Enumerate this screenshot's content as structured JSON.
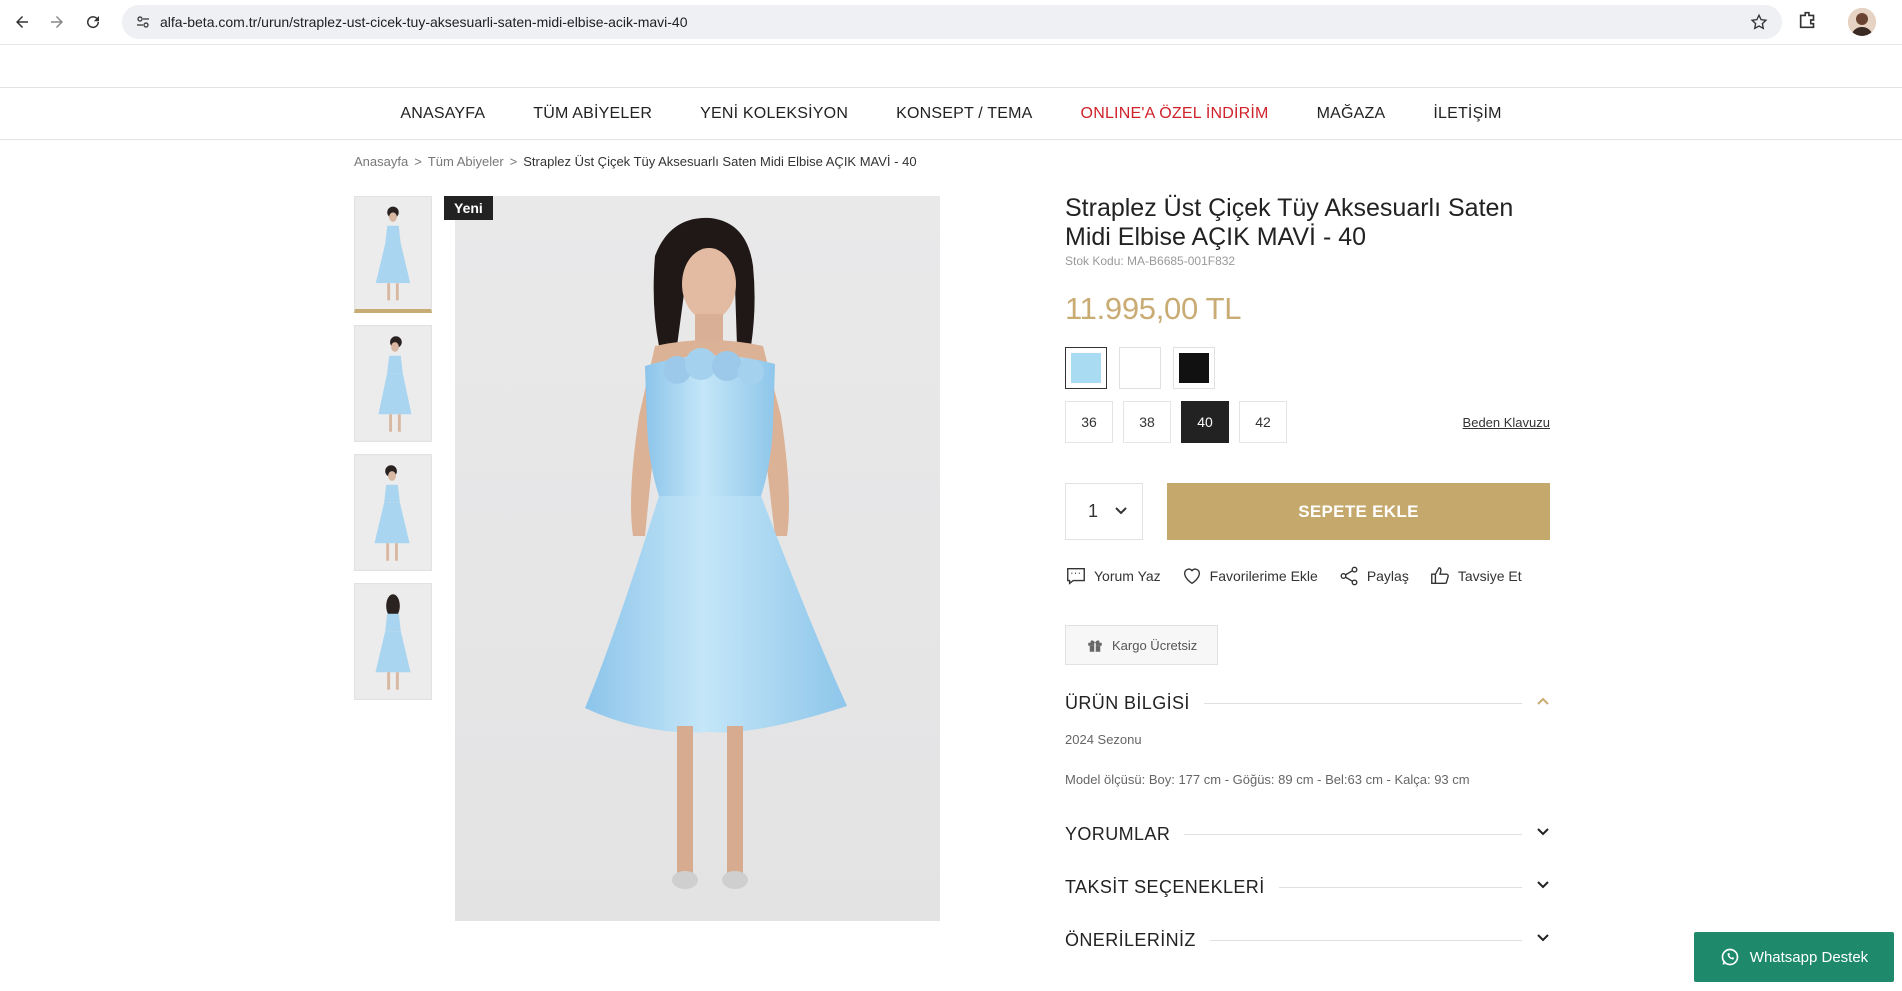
{
  "browser": {
    "url": "alfa-beta.com.tr/urun/straplez-ust-cicek-tuy-aksesuarli-saten-midi-elbise-acik-mavi-40"
  },
  "nav": {
    "items": [
      {
        "label": "ANASAYFA"
      },
      {
        "label": "TÜM ABİYELER"
      },
      {
        "label": "YENİ KOLEKSİYON"
      },
      {
        "label": "KONSEPT / TEMA"
      },
      {
        "label": "ONLINE'A ÖZEL İNDİRİM",
        "highlight": true
      },
      {
        "label": "MAĞAZA"
      },
      {
        "label": "İLETİŞİM"
      }
    ],
    "sale_color": "#d0222a"
  },
  "breadcrumb": {
    "home": "Anasayfa",
    "sep": ">",
    "category": "Tüm Abiyeler",
    "current": "Straplez Üst Çiçek Tüy Aksesuarlı Saten Midi Elbise AÇIK MAVİ - 40"
  },
  "gallery": {
    "badge": "Yeni",
    "dress_color": "#a9d5f0"
  },
  "product": {
    "title": "Straplez Üst Çiçek Tüy Aksesuarlı Saten Midi Elbise AÇIK MAVİ - 40",
    "sku": "Stok Kodu: MA-B6685-001F832",
    "price": "11.995,00 TL",
    "price_color": "#c9ab74",
    "colors": [
      {
        "hex": "#a9dcf2",
        "selected": true
      },
      {
        "hex": "#ffffff",
        "selected": false
      },
      {
        "hex": "#111111",
        "selected": false
      }
    ],
    "sizes": [
      {
        "label": "36"
      },
      {
        "label": "38"
      },
      {
        "label": "40",
        "selected": true
      },
      {
        "label": "42"
      }
    ],
    "size_guide": "Beden Klavuzu",
    "quantity": "1",
    "add_to_cart": "SEPETE EKLE",
    "cart_color": "#c5a86c",
    "actions": {
      "review": "Yorum Yaz",
      "favorite": "Favorilerime Ekle",
      "share": "Paylaş",
      "recommend": "Tavsiye Et"
    },
    "shipping": "Kargo Ücretsiz"
  },
  "accordion": {
    "info_title": "ÜRÜN BİLGİSİ",
    "season": "2024 Sezonu",
    "measurements": "Model ölçüsü: Boy: 177 cm - Göğüs: 89 cm - Bel:63 cm - Kalça: 93 cm",
    "reviews_title": "YORUMLAR",
    "installments_title": "TAKSİT SEÇENEKLERİ",
    "recommendations_title": "ÖNERİLERİNİZ"
  },
  "whatsapp": {
    "label": "Whatsapp Destek",
    "color": "#1e8a6b"
  }
}
